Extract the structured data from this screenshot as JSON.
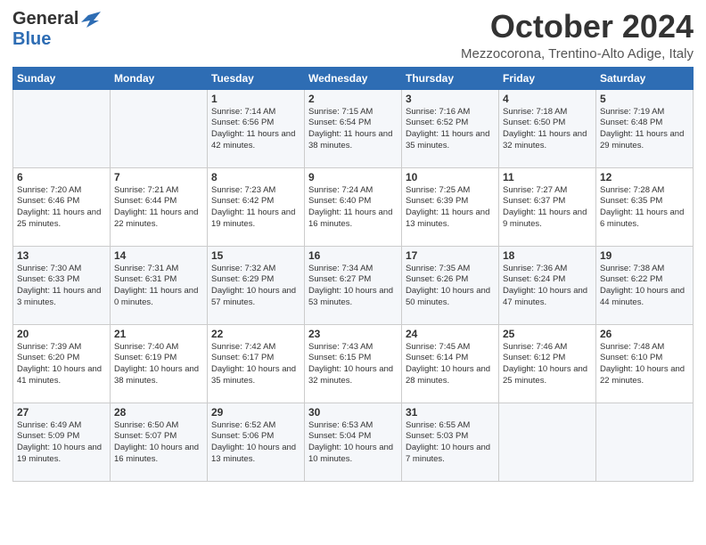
{
  "logo": {
    "line1": "General",
    "line2": "Blue"
  },
  "title": "October 2024",
  "location": "Mezzocorona, Trentino-Alto Adige, Italy",
  "days_of_week": [
    "Sunday",
    "Monday",
    "Tuesday",
    "Wednesday",
    "Thursday",
    "Friday",
    "Saturday"
  ],
  "weeks": [
    [
      {
        "day": "",
        "info": ""
      },
      {
        "day": "",
        "info": ""
      },
      {
        "day": "1",
        "info": "Sunrise: 7:14 AM\nSunset: 6:56 PM\nDaylight: 11 hours and 42 minutes."
      },
      {
        "day": "2",
        "info": "Sunrise: 7:15 AM\nSunset: 6:54 PM\nDaylight: 11 hours and 38 minutes."
      },
      {
        "day": "3",
        "info": "Sunrise: 7:16 AM\nSunset: 6:52 PM\nDaylight: 11 hours and 35 minutes."
      },
      {
        "day": "4",
        "info": "Sunrise: 7:18 AM\nSunset: 6:50 PM\nDaylight: 11 hours and 32 minutes."
      },
      {
        "day": "5",
        "info": "Sunrise: 7:19 AM\nSunset: 6:48 PM\nDaylight: 11 hours and 29 minutes."
      }
    ],
    [
      {
        "day": "6",
        "info": "Sunrise: 7:20 AM\nSunset: 6:46 PM\nDaylight: 11 hours and 25 minutes."
      },
      {
        "day": "7",
        "info": "Sunrise: 7:21 AM\nSunset: 6:44 PM\nDaylight: 11 hours and 22 minutes."
      },
      {
        "day": "8",
        "info": "Sunrise: 7:23 AM\nSunset: 6:42 PM\nDaylight: 11 hours and 19 minutes."
      },
      {
        "day": "9",
        "info": "Sunrise: 7:24 AM\nSunset: 6:40 PM\nDaylight: 11 hours and 16 minutes."
      },
      {
        "day": "10",
        "info": "Sunrise: 7:25 AM\nSunset: 6:39 PM\nDaylight: 11 hours and 13 minutes."
      },
      {
        "day": "11",
        "info": "Sunrise: 7:27 AM\nSunset: 6:37 PM\nDaylight: 11 hours and 9 minutes."
      },
      {
        "day": "12",
        "info": "Sunrise: 7:28 AM\nSunset: 6:35 PM\nDaylight: 11 hours and 6 minutes."
      }
    ],
    [
      {
        "day": "13",
        "info": "Sunrise: 7:30 AM\nSunset: 6:33 PM\nDaylight: 11 hours and 3 minutes."
      },
      {
        "day": "14",
        "info": "Sunrise: 7:31 AM\nSunset: 6:31 PM\nDaylight: 11 hours and 0 minutes."
      },
      {
        "day": "15",
        "info": "Sunrise: 7:32 AM\nSunset: 6:29 PM\nDaylight: 10 hours and 57 minutes."
      },
      {
        "day": "16",
        "info": "Sunrise: 7:34 AM\nSunset: 6:27 PM\nDaylight: 10 hours and 53 minutes."
      },
      {
        "day": "17",
        "info": "Sunrise: 7:35 AM\nSunset: 6:26 PM\nDaylight: 10 hours and 50 minutes."
      },
      {
        "day": "18",
        "info": "Sunrise: 7:36 AM\nSunset: 6:24 PM\nDaylight: 10 hours and 47 minutes."
      },
      {
        "day": "19",
        "info": "Sunrise: 7:38 AM\nSunset: 6:22 PM\nDaylight: 10 hours and 44 minutes."
      }
    ],
    [
      {
        "day": "20",
        "info": "Sunrise: 7:39 AM\nSunset: 6:20 PM\nDaylight: 10 hours and 41 minutes."
      },
      {
        "day": "21",
        "info": "Sunrise: 7:40 AM\nSunset: 6:19 PM\nDaylight: 10 hours and 38 minutes."
      },
      {
        "day": "22",
        "info": "Sunrise: 7:42 AM\nSunset: 6:17 PM\nDaylight: 10 hours and 35 minutes."
      },
      {
        "day": "23",
        "info": "Sunrise: 7:43 AM\nSunset: 6:15 PM\nDaylight: 10 hours and 32 minutes."
      },
      {
        "day": "24",
        "info": "Sunrise: 7:45 AM\nSunset: 6:14 PM\nDaylight: 10 hours and 28 minutes."
      },
      {
        "day": "25",
        "info": "Sunrise: 7:46 AM\nSunset: 6:12 PM\nDaylight: 10 hours and 25 minutes."
      },
      {
        "day": "26",
        "info": "Sunrise: 7:48 AM\nSunset: 6:10 PM\nDaylight: 10 hours and 22 minutes."
      }
    ],
    [
      {
        "day": "27",
        "info": "Sunrise: 6:49 AM\nSunset: 5:09 PM\nDaylight: 10 hours and 19 minutes."
      },
      {
        "day": "28",
        "info": "Sunrise: 6:50 AM\nSunset: 5:07 PM\nDaylight: 10 hours and 16 minutes."
      },
      {
        "day": "29",
        "info": "Sunrise: 6:52 AM\nSunset: 5:06 PM\nDaylight: 10 hours and 13 minutes."
      },
      {
        "day": "30",
        "info": "Sunrise: 6:53 AM\nSunset: 5:04 PM\nDaylight: 10 hours and 10 minutes."
      },
      {
        "day": "31",
        "info": "Sunrise: 6:55 AM\nSunset: 5:03 PM\nDaylight: 10 hours and 7 minutes."
      },
      {
        "day": "",
        "info": ""
      },
      {
        "day": "",
        "info": ""
      }
    ]
  ]
}
